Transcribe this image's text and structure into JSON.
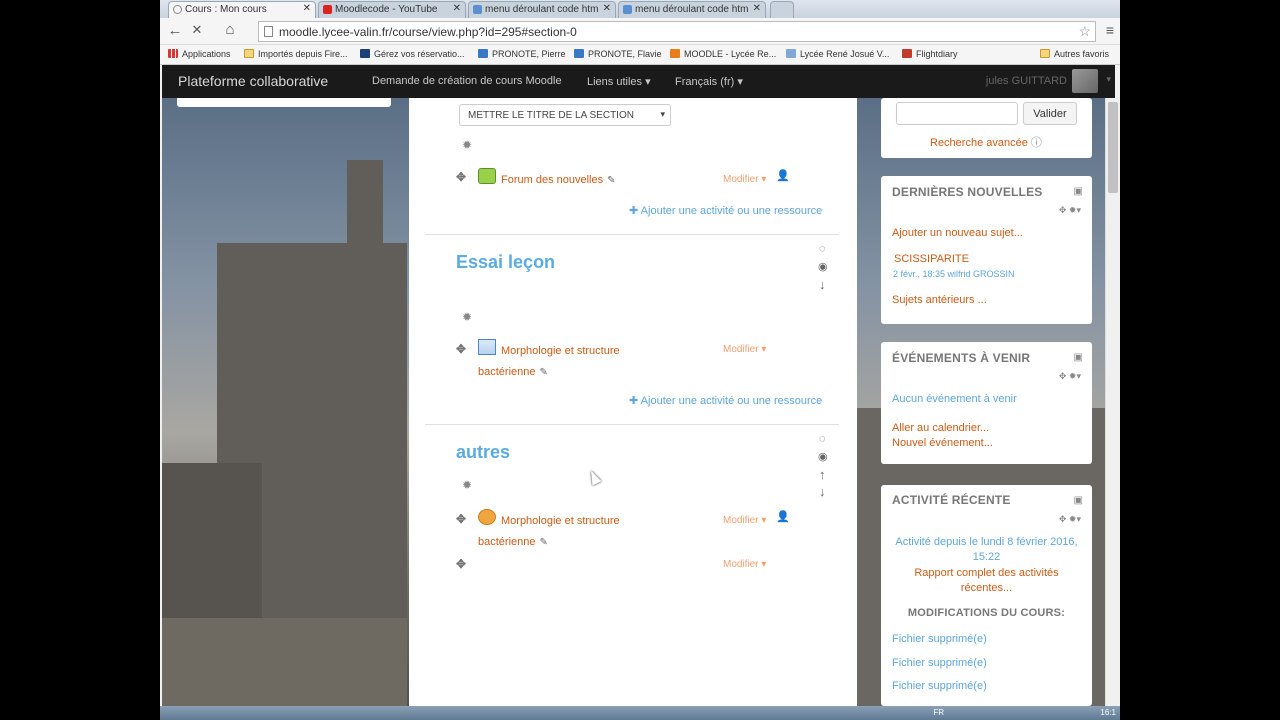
{
  "browser": {
    "tabs": [
      {
        "title": "Cours : Mon cours",
        "active": true
      },
      {
        "title": "Moodlecode - YouTube",
        "active": false
      },
      {
        "title": "menu déroulant code htm",
        "active": false
      },
      {
        "title": "menu déroulant code htm",
        "active": false
      }
    ],
    "close_glyph": "✕",
    "url": "moodle.lycee-valin.fr/course/view.php?id=295#section-0",
    "bookmarks": [
      "Applications",
      "Importés depuis Fire...",
      "Gérez vos réservatio...",
      "PRONOTE, Pierre",
      "PRONOTE, Flavie",
      "MOODLE - Lycée Re...",
      "Lycée René Josué V...",
      "Flightdiary",
      "Autres favoris"
    ]
  },
  "moodle_nav": {
    "brand": "Plateforme collaborative",
    "links": [
      "Demande de création de cours Moodle",
      "Liens utiles ▾",
      "Français (fr) ▾"
    ],
    "user": "jules GUITTARD",
    "caret": "▾"
  },
  "main": {
    "section_title_dropdown": "METTRE LE TITRE DE LA SECTION",
    "dropdown_caret": "▾",
    "modify_label": "Modifier ▾",
    "add_label": "Ajouter une activité ou une ressource",
    "sections": [
      {
        "title": "",
        "activities": [
          {
            "name": "Forum des nouvelles",
            "type": "forum"
          }
        ]
      },
      {
        "title": "Essai leçon",
        "activities": [
          {
            "name": "Morphologie et structure",
            "name2": "bactérienne",
            "type": "lesson"
          }
        ]
      },
      {
        "title": "autres",
        "activities": [
          {
            "name": "Morphologie et structure",
            "name2": "bactérienne",
            "type": "chat"
          }
        ]
      }
    ]
  },
  "search_block": {
    "button": "Valider",
    "advanced": "Recherche avancée"
  },
  "news_block": {
    "title": "DERNIÈRES NOUVELLES",
    "add_link": "Ajouter un nouveau sujet...",
    "post_title": "SCISSIPARITE",
    "post_meta": "2 févr., 18:35  wilfrid GROSSIN",
    "older": "Sujets antérieurs ..."
  },
  "events_block": {
    "title": "ÉVÉNEMENTS À VENIR",
    "none": "Aucun événement à venir",
    "calendar": "Aller au calendrier...",
    "new_event": "Nouvel événement..."
  },
  "activity_block": {
    "title": "ACTIVITÉ RÉCENTE",
    "since1": "Activité depuis le lundi 8 février 2016,",
    "since2": "15:22",
    "report1": "Rapport complet des activités",
    "report2": "récentes...",
    "changes_title": "MODIFICATIONS DU COURS:",
    "changes": [
      "Fichier supprimé(e)",
      "Fichier supprimé(e)",
      "Fichier supprimé(e)"
    ]
  },
  "taskbar": {
    "lang": "FR",
    "clock": "16:1"
  },
  "colors": {
    "accent_blue": "#5aace0",
    "link_orange": "#cc5b16",
    "navbar": "#1a1a1a"
  },
  "icons": [
    "settings-icon",
    "move-icon",
    "edit-icon",
    "person-icon",
    "highlight-icon",
    "eye-icon",
    "arrow-up-icon",
    "arrow-down-icon",
    "dock-icon"
  ]
}
